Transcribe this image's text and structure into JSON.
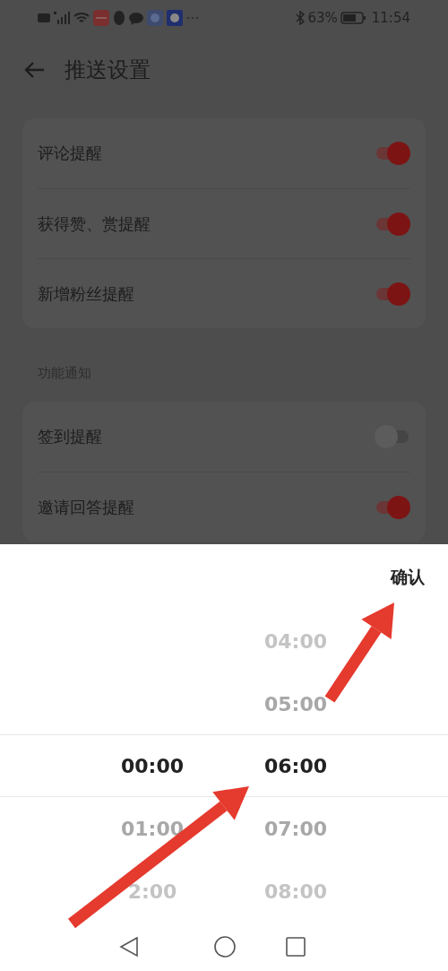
{
  "status_bar": {
    "battery": "63%",
    "time": "11:54"
  },
  "header": {
    "title": "推送设置"
  },
  "groups": [
    {
      "rows": [
        {
          "label": "评论提醒",
          "on": true
        },
        {
          "label": "获得赞、赏提醒",
          "on": true
        },
        {
          "label": "新增粉丝提醒",
          "on": true
        }
      ]
    },
    {
      "label": "功能通知",
      "rows": [
        {
          "label": "签到提醒",
          "on": false
        },
        {
          "label": "邀请回答提醒",
          "on": true
        }
      ]
    }
  ],
  "picker": {
    "confirm": "确认",
    "columns": [
      {
        "items": [
          {
            "label": "00:00",
            "selected": true
          },
          {
            "label": "01:00",
            "selected": false
          },
          {
            "label": "2:00",
            "selected": false
          }
        ]
      },
      {
        "items": [
          {
            "label": "04:00",
            "selected": false
          },
          {
            "label": "05:00",
            "selected": false
          },
          {
            "label": "06:00",
            "selected": true
          },
          {
            "label": "07:00",
            "selected": false
          },
          {
            "label": "08:00",
            "selected": false
          }
        ]
      }
    ]
  }
}
